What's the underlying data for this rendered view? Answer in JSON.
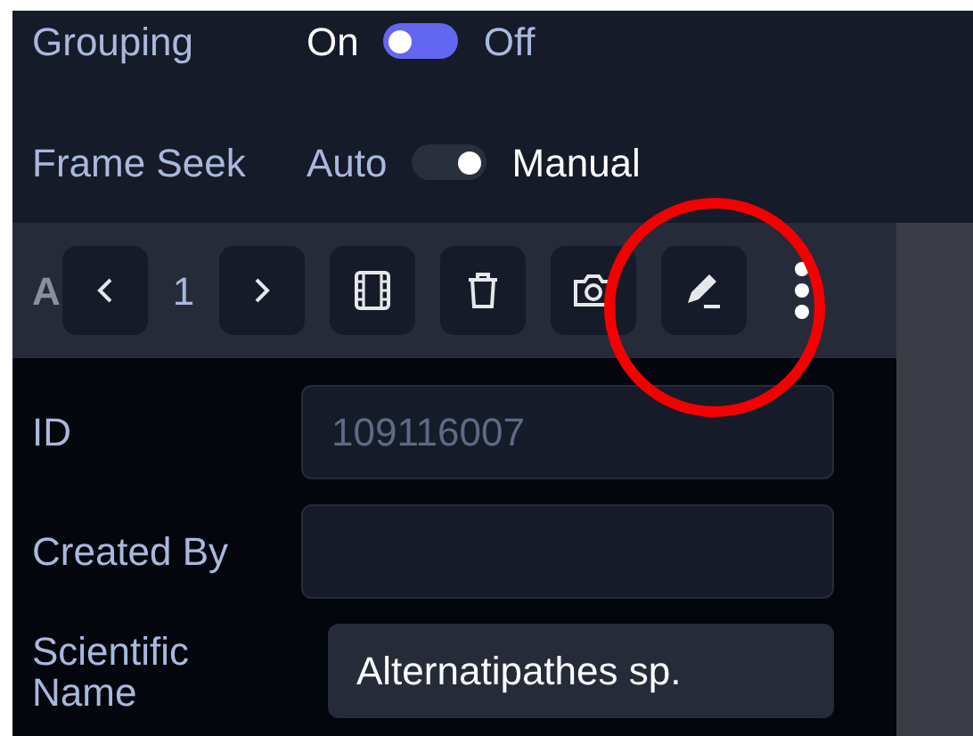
{
  "toggles": [
    {
      "label": "Grouping",
      "on": false,
      "options": [
        {
          "label": "On",
          "selected": true
        },
        {
          "label": "Off",
          "selected": false
        }
      ]
    },
    {
      "label": "Frame Seek",
      "on": true,
      "options": [
        {
          "label": "Auto",
          "selected": false
        },
        {
          "label": "Manual",
          "selected": true
        }
      ]
    }
  ],
  "toolbar": {
    "label": "A",
    "page": "1"
  },
  "fields": [
    {
      "label": "ID",
      "value": "109116007",
      "kind": "readonly"
    },
    {
      "label": "Created By",
      "kind": "input"
    },
    {
      "label": "Scientific Name",
      "value": "Alternatipathes sp.",
      "kind": "select"
    }
  ]
}
